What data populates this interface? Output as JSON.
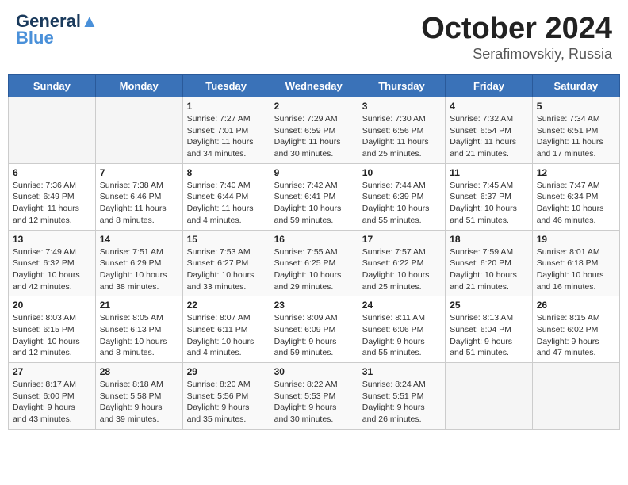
{
  "header": {
    "logo_line1": "General",
    "logo_line2": "Blue",
    "title": "October 2024",
    "subtitle": "Serafimovskiy, Russia"
  },
  "weekdays": [
    "Sunday",
    "Monday",
    "Tuesday",
    "Wednesday",
    "Thursday",
    "Friday",
    "Saturday"
  ],
  "weeks": [
    [
      {
        "day": "",
        "info": ""
      },
      {
        "day": "",
        "info": ""
      },
      {
        "day": "1",
        "info": "Sunrise: 7:27 AM\nSunset: 7:01 PM\nDaylight: 11 hours\nand 34 minutes."
      },
      {
        "day": "2",
        "info": "Sunrise: 7:29 AM\nSunset: 6:59 PM\nDaylight: 11 hours\nand 30 minutes."
      },
      {
        "day": "3",
        "info": "Sunrise: 7:30 AM\nSunset: 6:56 PM\nDaylight: 11 hours\nand 25 minutes."
      },
      {
        "day": "4",
        "info": "Sunrise: 7:32 AM\nSunset: 6:54 PM\nDaylight: 11 hours\nand 21 minutes."
      },
      {
        "day": "5",
        "info": "Sunrise: 7:34 AM\nSunset: 6:51 PM\nDaylight: 11 hours\nand 17 minutes."
      }
    ],
    [
      {
        "day": "6",
        "info": "Sunrise: 7:36 AM\nSunset: 6:49 PM\nDaylight: 11 hours\nand 12 minutes."
      },
      {
        "day": "7",
        "info": "Sunrise: 7:38 AM\nSunset: 6:46 PM\nDaylight: 11 hours\nand 8 minutes."
      },
      {
        "day": "8",
        "info": "Sunrise: 7:40 AM\nSunset: 6:44 PM\nDaylight: 11 hours\nand 4 minutes."
      },
      {
        "day": "9",
        "info": "Sunrise: 7:42 AM\nSunset: 6:41 PM\nDaylight: 10 hours\nand 59 minutes."
      },
      {
        "day": "10",
        "info": "Sunrise: 7:44 AM\nSunset: 6:39 PM\nDaylight: 10 hours\nand 55 minutes."
      },
      {
        "day": "11",
        "info": "Sunrise: 7:45 AM\nSunset: 6:37 PM\nDaylight: 10 hours\nand 51 minutes."
      },
      {
        "day": "12",
        "info": "Sunrise: 7:47 AM\nSunset: 6:34 PM\nDaylight: 10 hours\nand 46 minutes."
      }
    ],
    [
      {
        "day": "13",
        "info": "Sunrise: 7:49 AM\nSunset: 6:32 PM\nDaylight: 10 hours\nand 42 minutes."
      },
      {
        "day": "14",
        "info": "Sunrise: 7:51 AM\nSunset: 6:29 PM\nDaylight: 10 hours\nand 38 minutes."
      },
      {
        "day": "15",
        "info": "Sunrise: 7:53 AM\nSunset: 6:27 PM\nDaylight: 10 hours\nand 33 minutes."
      },
      {
        "day": "16",
        "info": "Sunrise: 7:55 AM\nSunset: 6:25 PM\nDaylight: 10 hours\nand 29 minutes."
      },
      {
        "day": "17",
        "info": "Sunrise: 7:57 AM\nSunset: 6:22 PM\nDaylight: 10 hours\nand 25 minutes."
      },
      {
        "day": "18",
        "info": "Sunrise: 7:59 AM\nSunset: 6:20 PM\nDaylight: 10 hours\nand 21 minutes."
      },
      {
        "day": "19",
        "info": "Sunrise: 8:01 AM\nSunset: 6:18 PM\nDaylight: 10 hours\nand 16 minutes."
      }
    ],
    [
      {
        "day": "20",
        "info": "Sunrise: 8:03 AM\nSunset: 6:15 PM\nDaylight: 10 hours\nand 12 minutes."
      },
      {
        "day": "21",
        "info": "Sunrise: 8:05 AM\nSunset: 6:13 PM\nDaylight: 10 hours\nand 8 minutes."
      },
      {
        "day": "22",
        "info": "Sunrise: 8:07 AM\nSunset: 6:11 PM\nDaylight: 10 hours\nand 4 minutes."
      },
      {
        "day": "23",
        "info": "Sunrise: 8:09 AM\nSunset: 6:09 PM\nDaylight: 9 hours\nand 59 minutes."
      },
      {
        "day": "24",
        "info": "Sunrise: 8:11 AM\nSunset: 6:06 PM\nDaylight: 9 hours\nand 55 minutes."
      },
      {
        "day": "25",
        "info": "Sunrise: 8:13 AM\nSunset: 6:04 PM\nDaylight: 9 hours\nand 51 minutes."
      },
      {
        "day": "26",
        "info": "Sunrise: 8:15 AM\nSunset: 6:02 PM\nDaylight: 9 hours\nand 47 minutes."
      }
    ],
    [
      {
        "day": "27",
        "info": "Sunrise: 8:17 AM\nSunset: 6:00 PM\nDaylight: 9 hours\nand 43 minutes."
      },
      {
        "day": "28",
        "info": "Sunrise: 8:18 AM\nSunset: 5:58 PM\nDaylight: 9 hours\nand 39 minutes."
      },
      {
        "day": "29",
        "info": "Sunrise: 8:20 AM\nSunset: 5:56 PM\nDaylight: 9 hours\nand 35 minutes."
      },
      {
        "day": "30",
        "info": "Sunrise: 8:22 AM\nSunset: 5:53 PM\nDaylight: 9 hours\nand 30 minutes."
      },
      {
        "day": "31",
        "info": "Sunrise: 8:24 AM\nSunset: 5:51 PM\nDaylight: 9 hours\nand 26 minutes."
      },
      {
        "day": "",
        "info": ""
      },
      {
        "day": "",
        "info": ""
      }
    ]
  ]
}
